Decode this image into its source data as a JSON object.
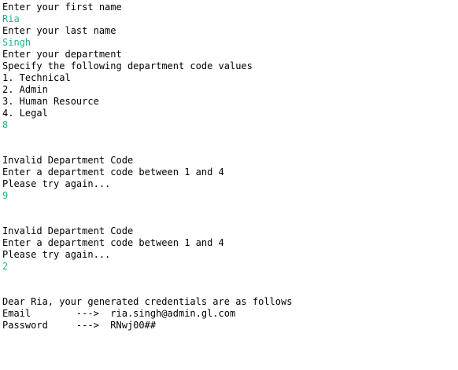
{
  "console": {
    "lines": [
      {
        "text": "Enter your first name",
        "type": "output"
      },
      {
        "text": "Ria",
        "type": "input"
      },
      {
        "text": "Enter your last name",
        "type": "output"
      },
      {
        "text": "Singh",
        "type": "input"
      },
      {
        "text": "Enter your department",
        "type": "output"
      },
      {
        "text": "Specify the following department code values",
        "type": "output"
      },
      {
        "text": "1. Technical",
        "type": "output"
      },
      {
        "text": "2. Admin",
        "type": "output"
      },
      {
        "text": "3. Human Resource",
        "type": "output"
      },
      {
        "text": "4. Legal",
        "type": "output"
      },
      {
        "text": "8",
        "type": "input"
      },
      {
        "text": "",
        "type": "blank"
      },
      {
        "text": "",
        "type": "blank"
      },
      {
        "text": "Invalid Department Code",
        "type": "output"
      },
      {
        "text": "Enter a department code between 1 and 4",
        "type": "output"
      },
      {
        "text": "Please try again...",
        "type": "output"
      },
      {
        "text": "9",
        "type": "input"
      },
      {
        "text": "",
        "type": "blank"
      },
      {
        "text": "",
        "type": "blank"
      },
      {
        "text": "Invalid Department Code",
        "type": "output"
      },
      {
        "text": "Enter a department code between 1 and 4",
        "type": "output"
      },
      {
        "text": "Please try again...",
        "type": "output"
      },
      {
        "text": "2",
        "type": "input"
      },
      {
        "text": "",
        "type": "blank"
      },
      {
        "text": "",
        "type": "blank"
      },
      {
        "text": "Dear Ria, your generated credentials are as follows",
        "type": "output"
      },
      {
        "text": "Email        --->  ria.singh@admin.gl.com",
        "type": "output"
      },
      {
        "text": "Password     --->  RNwj00##",
        "type": "output"
      }
    ]
  },
  "colors": {
    "output": "#000000",
    "input": "#1fb58f",
    "background": "#ffffff"
  }
}
